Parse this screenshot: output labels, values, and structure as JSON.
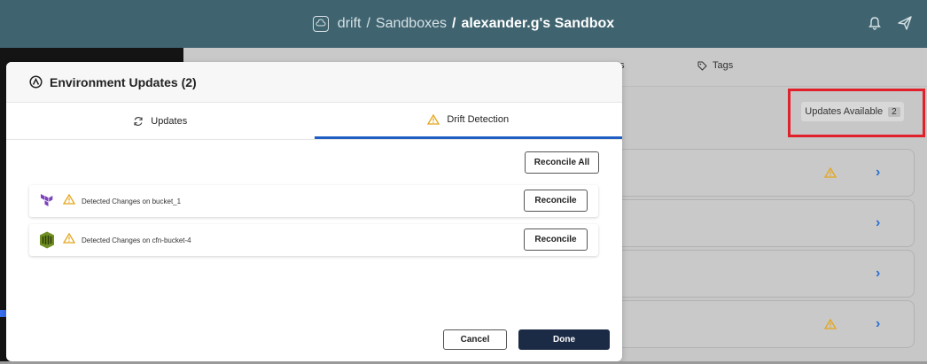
{
  "header": {
    "breadcrumb": [
      "drift",
      "Sandboxes",
      "alexander.g's Sandbox"
    ],
    "separator": "/"
  },
  "background": {
    "tabs": [
      "uts",
      "Tags"
    ],
    "updates_button": {
      "label": "Updates Available",
      "count": "2"
    }
  },
  "modal": {
    "title": "Environment Updates (2)",
    "tabs": [
      {
        "label": "Updates",
        "icon": "refresh-icon",
        "active": false
      },
      {
        "label": "Drift Detection",
        "icon": "warning-icon",
        "active": true
      }
    ],
    "reconcile_all_label": "Reconcile All",
    "changes": [
      {
        "provider": "terraform-icon",
        "text": "Detected Changes on bucket_1",
        "button": "Reconcile"
      },
      {
        "provider": "cloudformation-icon",
        "text": "Detected Changes on cfn-bucket-4",
        "button": "Reconcile"
      }
    ],
    "cancel_label": "Cancel",
    "done_label": "Done"
  },
  "colors": {
    "header_bg": "#3f6470",
    "tab_active": "#1f5fc4",
    "done_bg": "#1c2b45",
    "highlight_box": "#e0202a",
    "warning": "#e5a51a"
  }
}
